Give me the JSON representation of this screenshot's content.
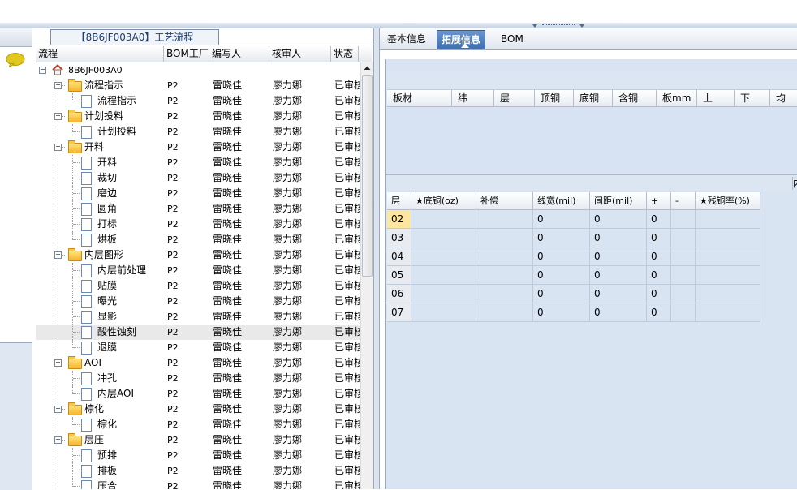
{
  "tree": {
    "caption": "【8B6JF003A0】工艺流程",
    "columns": [
      "流程",
      "BOM工厂",
      "编写人",
      "核审人",
      "状态"
    ],
    "root": "8B6JF003A0",
    "rows": [
      {
        "label": "流程指示",
        "type": "folder",
        "depth": 1,
        "bom": "P2",
        "writer": "雷晓佳",
        "reviewer": "廖力娜",
        "status": "已审核"
      },
      {
        "label": "流程指示",
        "type": "doc",
        "depth": 2,
        "bom": "P2",
        "writer": "雷晓佳",
        "reviewer": "廖力娜",
        "status": "已审核"
      },
      {
        "label": "计划投料",
        "type": "folder",
        "depth": 1,
        "bom": "P2",
        "writer": "雷晓佳",
        "reviewer": "廖力娜",
        "status": "已审核"
      },
      {
        "label": "计划投料",
        "type": "doc",
        "depth": 2,
        "bom": "P2",
        "writer": "雷晓佳",
        "reviewer": "廖力娜",
        "status": "已审核"
      },
      {
        "label": "开料",
        "type": "folder",
        "depth": 1,
        "bom": "P2",
        "writer": "雷晓佳",
        "reviewer": "廖力娜",
        "status": "已审核"
      },
      {
        "label": "开料",
        "type": "doc",
        "depth": 2,
        "bom": "P2",
        "writer": "雷晓佳",
        "reviewer": "廖力娜",
        "status": "已审核"
      },
      {
        "label": "裁切",
        "type": "doc",
        "depth": 2,
        "bom": "P2",
        "writer": "雷晓佳",
        "reviewer": "廖力娜",
        "status": "已审核"
      },
      {
        "label": "磨边",
        "type": "doc",
        "depth": 2,
        "bom": "P2",
        "writer": "雷晓佳",
        "reviewer": "廖力娜",
        "status": "已审核"
      },
      {
        "label": "圆角",
        "type": "doc",
        "depth": 2,
        "bom": "P2",
        "writer": "雷晓佳",
        "reviewer": "廖力娜",
        "status": "已审核"
      },
      {
        "label": "打标",
        "type": "doc",
        "depth": 2,
        "bom": "P2",
        "writer": "雷晓佳",
        "reviewer": "廖力娜",
        "status": "已审核"
      },
      {
        "label": "烘板",
        "type": "doc",
        "depth": 2,
        "bom": "P2",
        "writer": "雷晓佳",
        "reviewer": "廖力娜",
        "status": "已审核"
      },
      {
        "label": "内层图形",
        "type": "folder",
        "depth": 1,
        "bom": "P2",
        "writer": "雷晓佳",
        "reviewer": "廖力娜",
        "status": "已审核"
      },
      {
        "label": "内层前处理",
        "type": "doc",
        "depth": 2,
        "bom": "P2",
        "writer": "雷晓佳",
        "reviewer": "廖力娜",
        "status": "已审核"
      },
      {
        "label": "贴膜",
        "type": "doc",
        "depth": 2,
        "bom": "P2",
        "writer": "雷晓佳",
        "reviewer": "廖力娜",
        "status": "已审核"
      },
      {
        "label": "曝光",
        "type": "doc",
        "depth": 2,
        "bom": "P2",
        "writer": "雷晓佳",
        "reviewer": "廖力娜",
        "status": "已审核"
      },
      {
        "label": "显影",
        "type": "doc",
        "depth": 2,
        "bom": "P2",
        "writer": "雷晓佳",
        "reviewer": "廖力娜",
        "status": "已审核"
      },
      {
        "label": "酸性蚀刻",
        "type": "doc",
        "depth": 2,
        "bom": "P2",
        "writer": "雷晓佳",
        "reviewer": "廖力娜",
        "status": "已审核",
        "selected": true
      },
      {
        "label": "退膜",
        "type": "doc",
        "depth": 2,
        "bom": "P2",
        "writer": "雷晓佳",
        "reviewer": "廖力娜",
        "status": "已审核"
      },
      {
        "label": "AOI",
        "type": "folder",
        "depth": 1,
        "bom": "P2",
        "writer": "雷晓佳",
        "reviewer": "廖力娜",
        "status": "已审核"
      },
      {
        "label": "冲孔",
        "type": "doc",
        "depth": 2,
        "bom": "P2",
        "writer": "雷晓佳",
        "reviewer": "廖力娜",
        "status": "已审核"
      },
      {
        "label": "内层AOI",
        "type": "doc",
        "depth": 2,
        "bom": "P2",
        "writer": "雷晓佳",
        "reviewer": "廖力娜",
        "status": "已审核"
      },
      {
        "label": "棕化",
        "type": "folder",
        "depth": 1,
        "bom": "P2",
        "writer": "雷晓佳",
        "reviewer": "廖力娜",
        "status": "已审核"
      },
      {
        "label": "棕化",
        "type": "doc",
        "depth": 2,
        "bom": "P2",
        "writer": "雷晓佳",
        "reviewer": "廖力娜",
        "status": "已审核"
      },
      {
        "label": "层压",
        "type": "folder",
        "depth": 1,
        "bom": "P2",
        "writer": "雷晓佳",
        "reviewer": "廖力娜",
        "status": "已审核"
      },
      {
        "label": "预排",
        "type": "doc",
        "depth": 2,
        "bom": "P2",
        "writer": "雷晓佳",
        "reviewer": "廖力娜",
        "status": "已审核"
      },
      {
        "label": "排板",
        "type": "doc",
        "depth": 2,
        "bom": "P2",
        "writer": "雷晓佳",
        "reviewer": "廖力娜",
        "status": "已审核"
      },
      {
        "label": "压合",
        "type": "doc",
        "depth": 2,
        "bom": "P2",
        "writer": "雷晓佳",
        "reviewer": "廖力娜",
        "status": "已审核"
      }
    ]
  },
  "tabs": [
    {
      "label": "基本信息",
      "active": false
    },
    {
      "label": "拓展信息",
      "active": true
    },
    {
      "label": "BOM",
      "active": false
    }
  ],
  "grid1": {
    "columns": [
      "板材",
      "纬",
      "层",
      "顶铜",
      "底铜",
      "含铜",
      "板mm",
      "上",
      "下",
      "均"
    ]
  },
  "grid2": {
    "strip_text": "内",
    "columns": [
      "层",
      "★底铜(oz)",
      "补偿",
      "线宽(mil)",
      "间距(mil)",
      "+",
      "-",
      "★残铜率(%)"
    ],
    "rows": [
      {
        "layer": "02",
        "base_cu": "",
        "comp": "",
        "width": "0",
        "space": "0",
        "plus": "0",
        "minus": "",
        "residual": "",
        "selected": true
      },
      {
        "layer": "03",
        "base_cu": "",
        "comp": "",
        "width": "0",
        "space": "0",
        "plus": "0",
        "minus": "",
        "residual": ""
      },
      {
        "layer": "04",
        "base_cu": "",
        "comp": "",
        "width": "0",
        "space": "0",
        "plus": "0",
        "minus": "",
        "residual": ""
      },
      {
        "layer": "05",
        "base_cu": "",
        "comp": "",
        "width": "0",
        "space": "0",
        "plus": "0",
        "minus": "",
        "residual": ""
      },
      {
        "layer": "06",
        "base_cu": "",
        "comp": "",
        "width": "0",
        "space": "0",
        "plus": "0",
        "minus": "",
        "residual": ""
      },
      {
        "layer": "07",
        "base_cu": "",
        "comp": "",
        "width": "0",
        "space": "0",
        "plus": "0",
        "minus": "",
        "residual": ""
      }
    ]
  }
}
